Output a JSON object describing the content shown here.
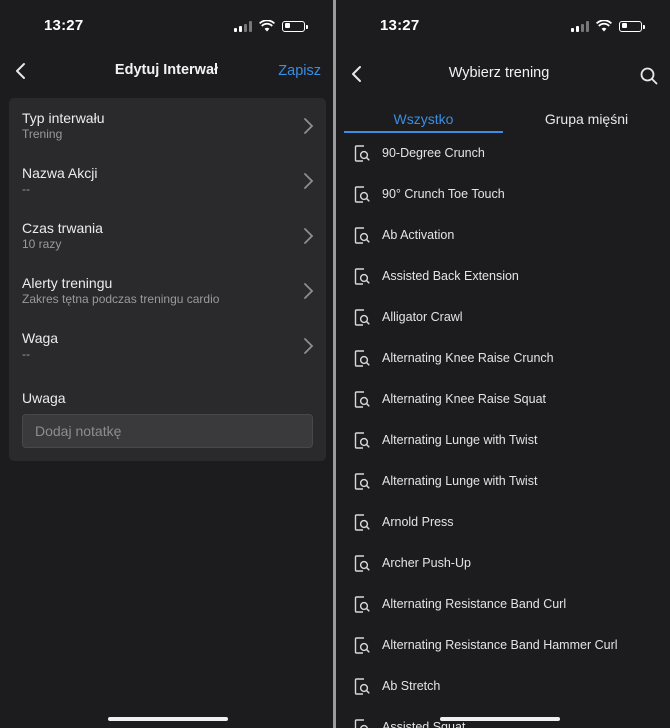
{
  "left": {
    "status": {
      "time": "13:27"
    },
    "nav": {
      "title": "Edytuj Interwał",
      "action": "Zapisz"
    },
    "rows": [
      {
        "title": "Typ interwału",
        "value": "Trening"
      },
      {
        "title": "Nazwa Akcji",
        "value": "--"
      },
      {
        "title": "Czas trwania",
        "value": "10 razy"
      },
      {
        "title": "Alerty treningu",
        "value": "Zakres tętna podczas treningu cardio"
      },
      {
        "title": "Waga",
        "value": "--"
      }
    ],
    "note": {
      "label": "Uwaga",
      "placeholder": "Dodaj notatkę"
    }
  },
  "right": {
    "status": {
      "time": "13:27"
    },
    "nav": {
      "title": "Wybierz trening"
    },
    "tabs": [
      {
        "label": "Wszystko",
        "active": true
      },
      {
        "label": "Grupa mięśni",
        "active": false
      }
    ],
    "items": [
      "90-Degree Crunch",
      "90° Crunch Toe Touch",
      "Ab Activation",
      "Assisted Back Extension",
      "Alligator Crawl",
      "Alternating Knee Raise Crunch",
      "Alternating Knee Raise Squat",
      "Alternating Lunge with Twist",
      "Alternating Lunge with Twist",
      "Arnold Press",
      "Archer Push-Up",
      "Alternating Resistance Band Curl",
      "Alternating Resistance Band Hammer Curl",
      "Ab Stretch",
      "Assisted Squat"
    ]
  },
  "colors": {
    "accent": "#3b8de0",
    "background": "#1c1c1f",
    "card": "#2a2a2c"
  },
  "icons": {
    "back": "chevron-left-icon",
    "row": "chevron-right-icon",
    "search": "search-icon",
    "item": "exercise-search-icon"
  }
}
